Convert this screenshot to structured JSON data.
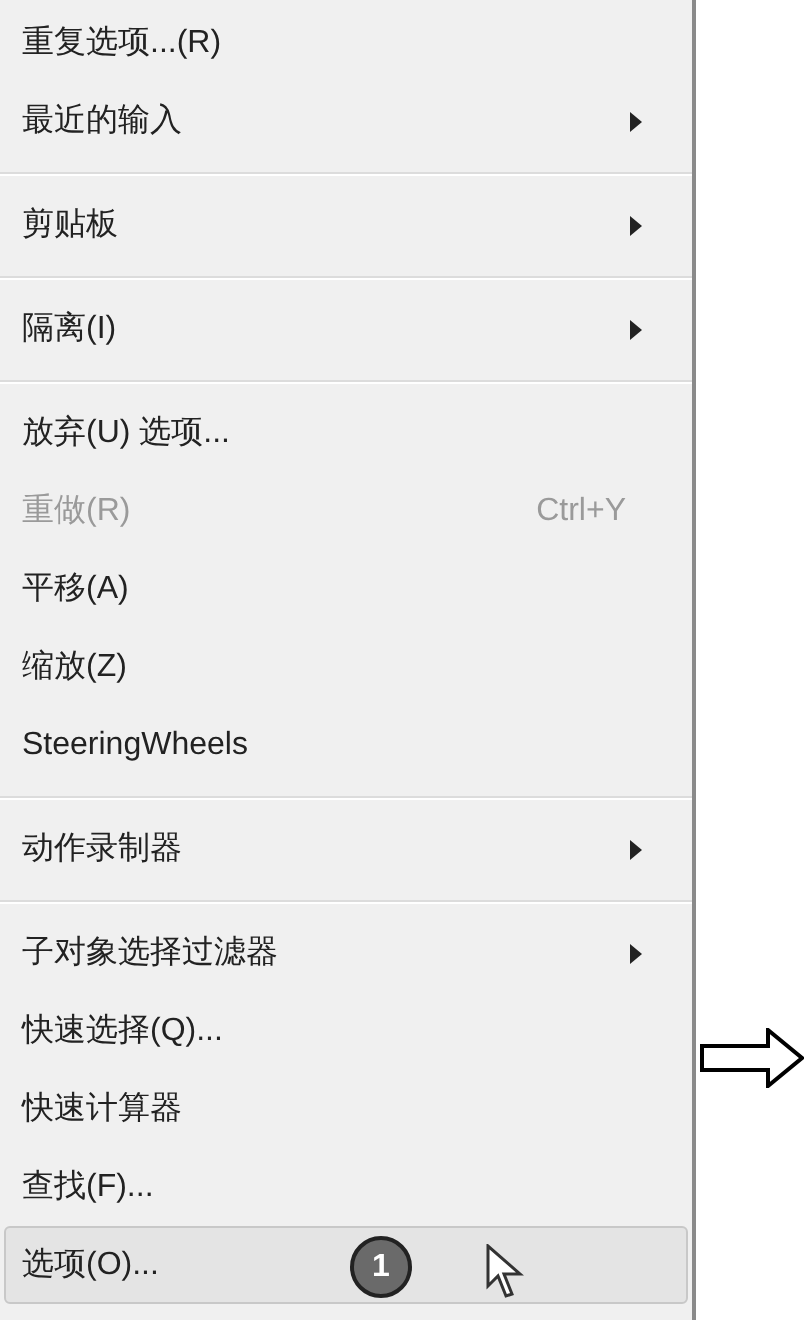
{
  "menu": {
    "sections": [
      {
        "items": [
          {
            "label": "重复选项...(R)",
            "submenu": false,
            "disabled": false,
            "selected": false
          },
          {
            "label": "最近的输入",
            "submenu": true,
            "disabled": false,
            "selected": false
          }
        ]
      },
      {
        "items": [
          {
            "label": "剪贴板",
            "submenu": true,
            "disabled": false,
            "selected": false
          }
        ]
      },
      {
        "items": [
          {
            "label": "隔离(I)",
            "submenu": true,
            "disabled": false,
            "selected": false
          }
        ]
      },
      {
        "items": [
          {
            "label": "放弃(U) 选项...",
            "submenu": false,
            "disabled": false,
            "selected": false
          },
          {
            "label": "重做(R)",
            "shortcut": "Ctrl+Y",
            "submenu": false,
            "disabled": true,
            "selected": false
          },
          {
            "label": "平移(A)",
            "submenu": false,
            "disabled": false,
            "selected": false
          },
          {
            "label": "缩放(Z)",
            "submenu": false,
            "disabled": false,
            "selected": false
          },
          {
            "label": "SteeringWheels",
            "submenu": false,
            "disabled": false,
            "selected": false
          }
        ]
      },
      {
        "items": [
          {
            "label": "动作录制器",
            "submenu": true,
            "disabled": false,
            "selected": false
          }
        ]
      },
      {
        "items": [
          {
            "label": "子对象选择过滤器",
            "submenu": true,
            "disabled": false,
            "selected": false
          },
          {
            "label": "快速选择(Q)...",
            "submenu": false,
            "disabled": false,
            "selected": false
          },
          {
            "label": "快速计算器",
            "submenu": false,
            "disabled": false,
            "selected": false
          },
          {
            "label": "查找(F)...",
            "submenu": false,
            "disabled": false,
            "selected": false
          },
          {
            "label": "选项(O)...",
            "submenu": false,
            "disabled": false,
            "selected": true,
            "callout": "1",
            "pointer": true
          }
        ]
      }
    ]
  }
}
